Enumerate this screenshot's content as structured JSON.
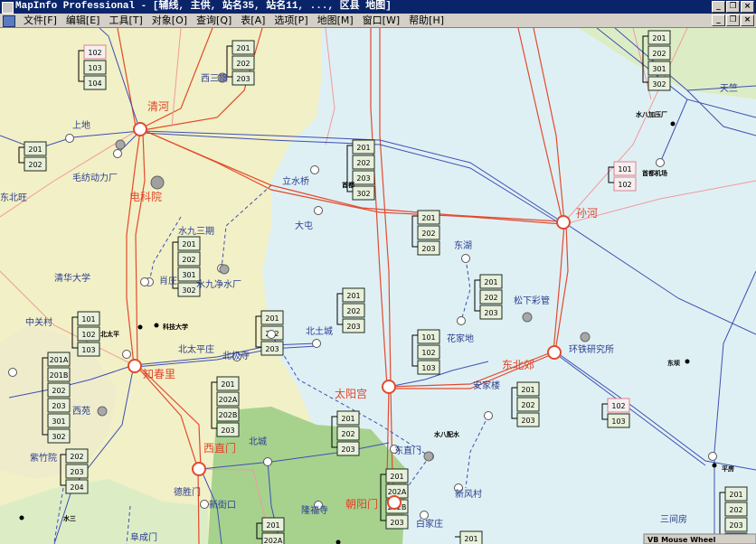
{
  "window": {
    "title": "MapInfo Professional - [辅线, 主供, 站名35, 站名11, ..., 区县 地图]",
    "controls": [
      "_",
      "❐",
      "×"
    ]
  },
  "menu": {
    "items": [
      "文件[F]",
      "编辑[E]",
      "工具[T]",
      "对象[O]",
      "查询[Q]",
      "表[A]",
      "选项[P]",
      "地图[M]",
      "窗口[W]",
      "帮助[H]"
    ],
    "doc_controls": [
      "_",
      "❐",
      "×"
    ]
  },
  "map": {
    "colors": {
      "plain": "#f2f0c6",
      "water": "#dff0f4",
      "green": "#a6d28e",
      "lightgreen": "#dcedc6",
      "hv_line": "#e24a2e",
      "lv_line": "#3d4fb5",
      "pink_line": "#f19a9a",
      "box_fill": "#e8f0dc"
    },
    "red_stations": [
      {
        "id": "qinghe",
        "label": "清河"
      },
      {
        "id": "zhichunli",
        "label": "知春里"
      },
      {
        "id": "sunhe",
        "label": "孙河"
      },
      {
        "id": "taiyanggong",
        "label": "太阳宫"
      },
      {
        "id": "dongbeijiao",
        "label": "东北郊"
      },
      {
        "id": "xizhimen",
        "label": "西直门"
      },
      {
        "id": "chaoyangmen",
        "label": "朝阳门"
      }
    ],
    "landmarks": [
      "电科院"
    ],
    "place_labels": [
      "西三旗",
      "上地",
      "毛纺动力厂",
      "东北旺",
      "立水桥",
      "大屯",
      "水九三期",
      "清华大学",
      "肖庄",
      "水九净水厂",
      "中关村",
      "科技大学",
      "北太平庄",
      "北极寺",
      "北土城",
      "西苑",
      "紫竹院",
      "北城",
      "新街口",
      "德胜门",
      "隆福寺",
      "东直门",
      "新风村",
      "白家庄",
      "水八配水",
      "安家楼",
      "花家地",
      "东湖",
      "松下彩管",
      "环铁研究所",
      "天竺",
      "水八加压厂",
      "首都机场",
      "东坝",
      "平房",
      "三间房",
      "阜成门",
      "水三",
      "北太平",
      "首都"
    ],
    "boxes": {
      "nw": [
        "102",
        "103",
        "104"
      ],
      "xsq": [
        "201",
        "202",
        "203"
      ],
      "w1": [
        "201",
        "202"
      ],
      "lsq": [
        "201",
        "202",
        "203",
        "302"
      ],
      "shz": [
        "201",
        "202",
        "301",
        "302"
      ],
      "zgc": [
        "101",
        "102",
        "103"
      ],
      "wcol": [
        "201A",
        "201B",
        "202",
        "203",
        "301",
        "302"
      ],
      "zzy": [
        "202",
        "203",
        "204"
      ],
      "btc": [
        "201",
        "202",
        "203"
      ],
      "bjs": [
        "201",
        "202",
        "203"
      ],
      "bc": [
        "201",
        "202A",
        "202B",
        "203"
      ],
      "xjk": [
        "201",
        "202A"
      ],
      "dh": [
        "201",
        "202",
        "203"
      ],
      "tyg": [
        "201",
        "202",
        "203"
      ],
      "hjd": [
        "101",
        "102",
        "103"
      ],
      "shr": [
        "201",
        "202",
        "203"
      ],
      "sunhe": [
        "101",
        "102"
      ],
      "tianzhu": [
        "201",
        "202",
        "301",
        "302"
      ],
      "ajl": [
        "201",
        "202",
        "203"
      ],
      "dbj": [
        "102",
        "103"
      ],
      "dzm": [
        "201",
        "202A",
        "202B",
        "203"
      ],
      "bjz": [
        "201"
      ],
      "pf": [
        "201",
        "202",
        "203",
        "301"
      ]
    },
    "hscroll_label": "VB Mouse Wheel"
  }
}
